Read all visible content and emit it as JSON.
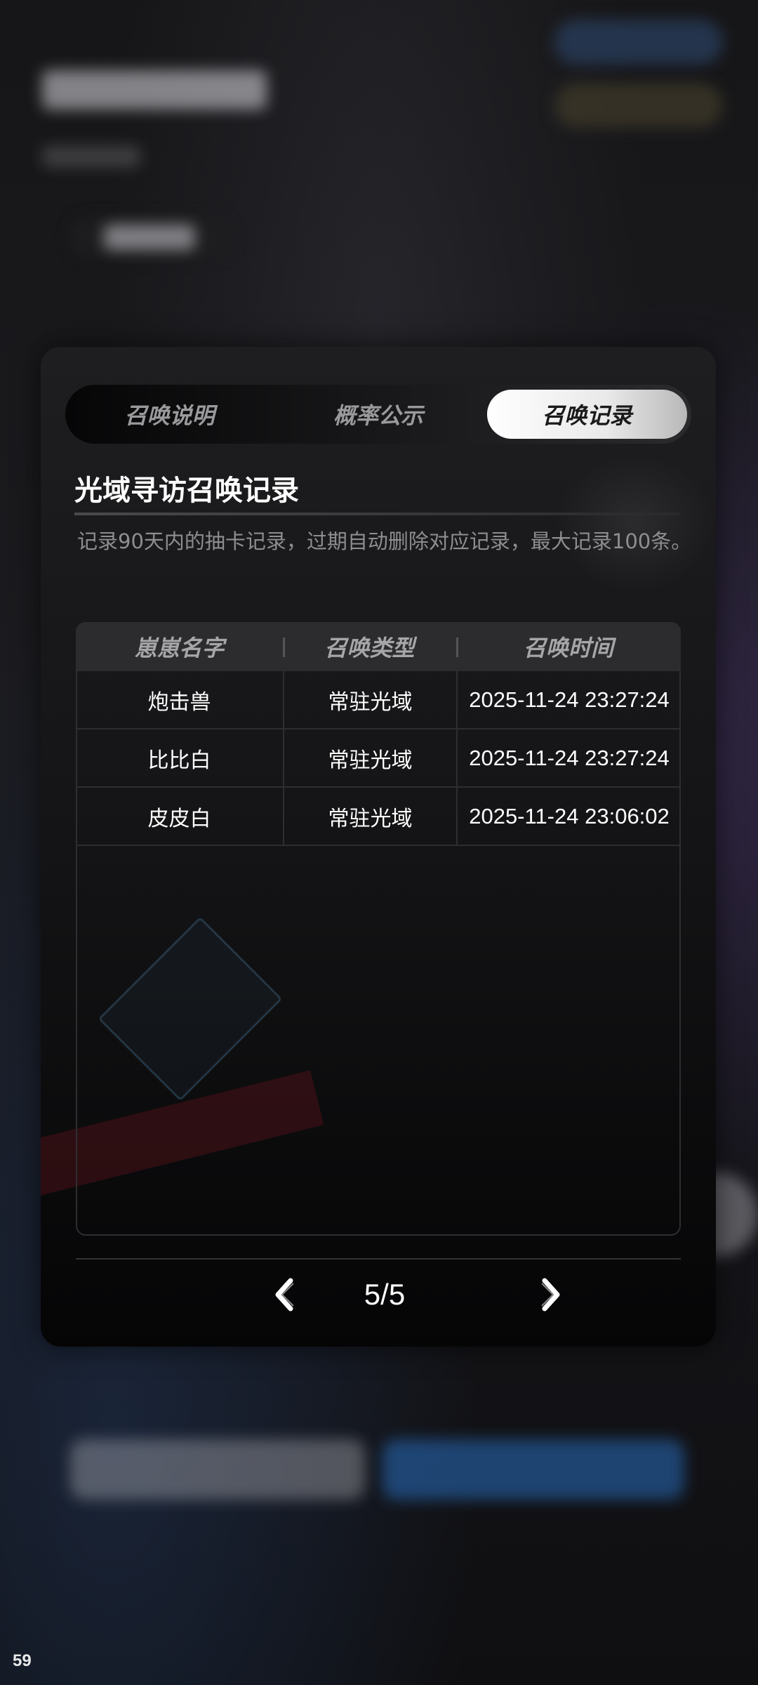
{
  "status": {
    "fps": "59"
  },
  "tabs": [
    {
      "label": "召唤说明",
      "active": false
    },
    {
      "label": "概率公示",
      "active": false
    },
    {
      "label": "召唤记录",
      "active": true
    }
  ],
  "record": {
    "title": "光域寻访召唤记录",
    "description": "记录90天内的抽卡记录，过期自动删除对应记录，最大记录100条。"
  },
  "table": {
    "headers": [
      "崽崽名字",
      "召唤类型",
      "召唤时间"
    ],
    "rows": [
      {
        "name": "炮击兽",
        "type": "常驻光域",
        "time": "2025-11-24 23:27:24"
      },
      {
        "name": "比比白",
        "type": "常驻光域",
        "time": "2025-11-24 23:27:24"
      },
      {
        "name": "皮皮白",
        "type": "常驻光域",
        "time": "2025-11-24 23:06:02"
      }
    ]
  },
  "pagination": {
    "label": "5/5",
    "current": 5,
    "total": 5
  },
  "icons": {
    "prev": "chevron-left-icon",
    "next": "chevron-right-icon"
  },
  "colors": {
    "accent_tab": "#f2f2f2",
    "panel": "#141416",
    "text_muted": "#8e8e90"
  }
}
